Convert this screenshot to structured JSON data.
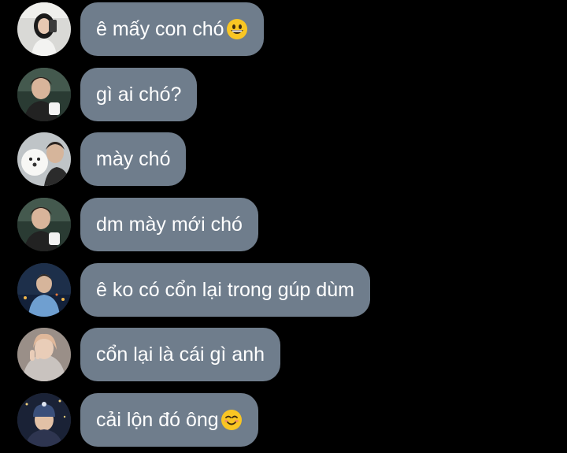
{
  "messages": [
    {
      "text": "ê mấy con chó",
      "emoji": "grinning-face-icon",
      "avatar": "avatar-girl-mirror-selfie"
    },
    {
      "text": "gì ai chó?",
      "emoji": "",
      "avatar": "avatar-guy-with-mug"
    },
    {
      "text": "mày chó",
      "emoji": "",
      "avatar": "avatar-guy-with-white-dog"
    },
    {
      "text": "dm mày mới chó",
      "emoji": "",
      "avatar": "avatar-guy-with-mug"
    },
    {
      "text": "ê ko có cổn lại trong gúp dùm",
      "emoji": "",
      "avatar": "avatar-person-blue-hoodie-night"
    },
    {
      "text": "cổn lại là cái gì anh",
      "emoji": "",
      "avatar": "avatar-person-peace-sign"
    },
    {
      "text": "cải lộn đó ông",
      "emoji": "smiling-face-icon",
      "avatar": "avatar-person-beanie-night"
    }
  ],
  "colors": {
    "background": "#000000",
    "bubble": "#6f7d8c",
    "text": "#ffffff"
  }
}
